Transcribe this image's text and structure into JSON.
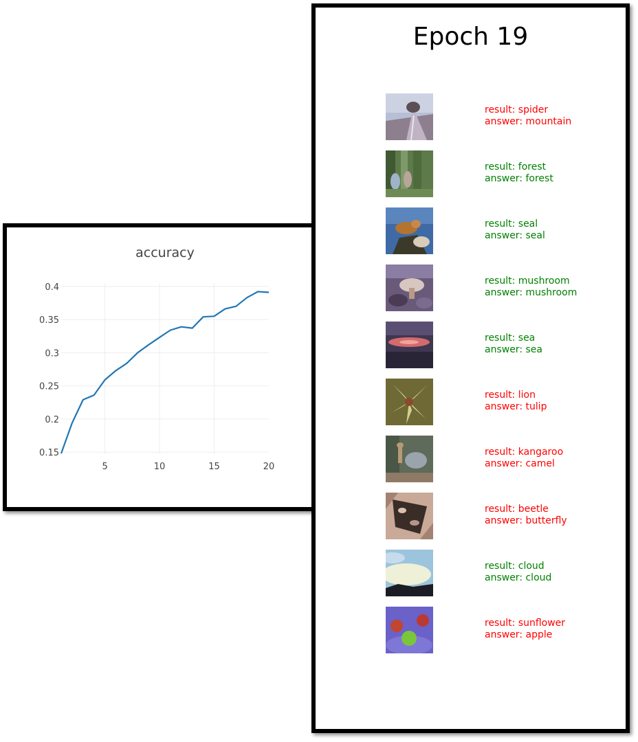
{
  "colors": {
    "correct": "#008000",
    "wrong": "#ff0000",
    "line": "#1f77b4",
    "grid": "#eeeeee",
    "tick_text": "#444444"
  },
  "chart_data": {
    "type": "line",
    "title": "accuracy",
    "xlabel": "",
    "ylabel": "",
    "x": [
      1,
      2,
      3,
      4,
      5,
      6,
      7,
      8,
      9,
      10,
      11,
      12,
      13,
      14,
      15,
      16,
      17,
      18,
      19,
      20
    ],
    "series": [
      {
        "values": [
          0.148,
          0.194,
          0.229,
          0.236,
          0.259,
          0.273,
          0.284,
          0.3,
          0.312,
          0.323,
          0.334,
          0.339,
          0.337,
          0.354,
          0.355,
          0.366,
          0.37,
          0.383,
          0.392,
          0.391
        ]
      }
    ],
    "xticks": [
      5,
      10,
      15,
      20
    ],
    "xtick_labels": [
      "5",
      "10",
      "15",
      "20"
    ],
    "yticks": [
      0.15,
      0.2,
      0.25,
      0.3,
      0.35,
      0.4
    ],
    "ytick_labels": [
      "0.15",
      "0.2",
      "0.25",
      "0.3",
      "0.35",
      "0.4"
    ],
    "xlim": [
      1,
      20
    ],
    "ylim": [
      0.147,
      0.405
    ],
    "grid": true,
    "legend": "none"
  },
  "epoch": {
    "title": "Epoch 19"
  },
  "results": [
    {
      "result": "result: spider",
      "answer": "answer: mountain",
      "correct": false,
      "image": "mountain-road-thumbnail"
    },
    {
      "result": "result: forest",
      "answer": "answer: forest",
      "correct": true,
      "image": "forest-thumbnail"
    },
    {
      "result": "result: seal",
      "answer": "answer: seal",
      "correct": true,
      "image": "seal-thumbnail"
    },
    {
      "result": "result: mushroom",
      "answer": "answer: mushroom",
      "correct": true,
      "image": "mushroom-thumbnail"
    },
    {
      "result": "result: sea",
      "answer": "answer: sea",
      "correct": true,
      "image": "sea-sunset-thumbnail"
    },
    {
      "result": "result: lion",
      "answer": "answer: tulip",
      "correct": false,
      "image": "tulip-flower-thumbnail"
    },
    {
      "result": "result: kangaroo",
      "answer": "answer: camel",
      "correct": false,
      "image": "camel-thumbnail"
    },
    {
      "result": "result: beetle",
      "answer": "answer: butterfly",
      "correct": false,
      "image": "butterfly-thumbnail"
    },
    {
      "result": "result: cloud",
      "answer": "answer: cloud",
      "correct": true,
      "image": "cloud-sky-thumbnail"
    },
    {
      "result": "result: sunflower",
      "answer": "answer: apple",
      "correct": false,
      "image": "apples-thumbnail"
    }
  ]
}
